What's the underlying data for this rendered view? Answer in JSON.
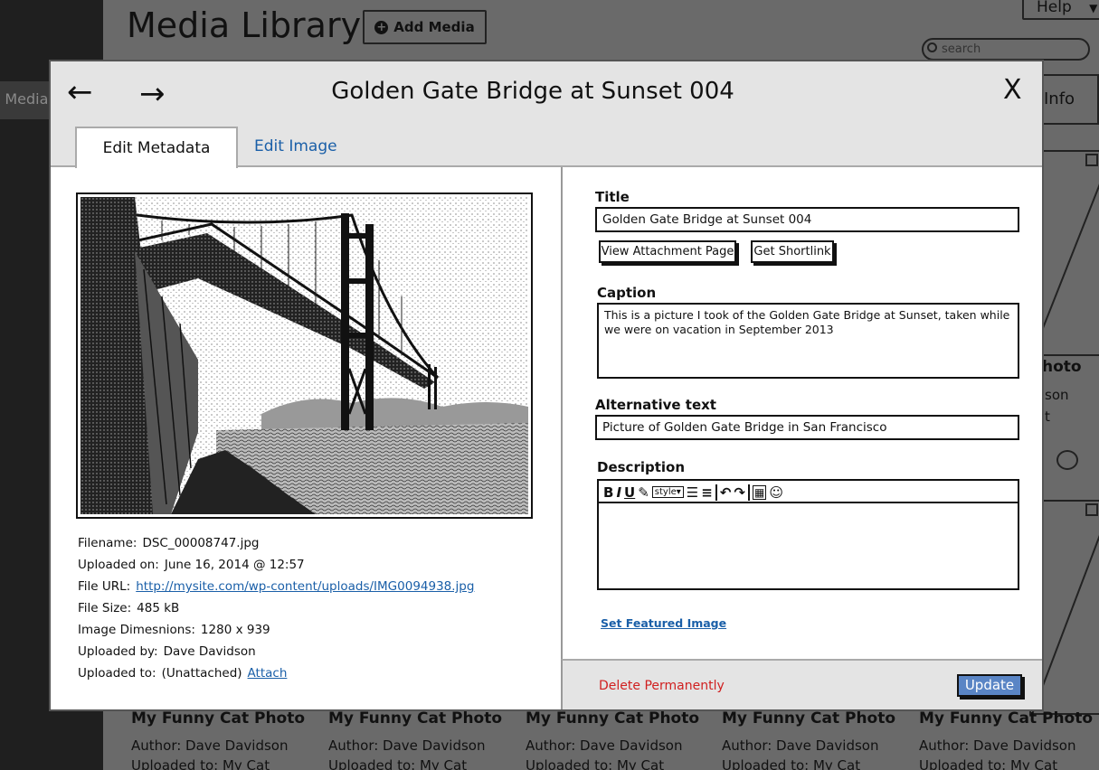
{
  "background": {
    "sidebar_active_label": "Media",
    "page_title": "Media Library",
    "add_media_label": "Add Media",
    "help_label": "Help",
    "search_placeholder": "search",
    "info_label": "Info",
    "peek": {
      "title": "hoto",
      "line1": "son",
      "line2": "t"
    },
    "cards": [
      {
        "title": "My Funny Cat Photo",
        "author": "Author: Dave Davidson",
        "uploaded": "Uploaded to: My Cat"
      },
      {
        "title": "My Funny Cat Photo",
        "author": "Author: Dave Davidson",
        "uploaded": "Uploaded to: My Cat"
      },
      {
        "title": "My Funny Cat Photo",
        "author": "Author: Dave Davidson",
        "uploaded": "Uploaded to: My Cat"
      },
      {
        "title": "My Funny Cat Photo",
        "author": "Author: Dave Davidson",
        "uploaded": "Uploaded to: My Cat"
      },
      {
        "title": "My Funny Cat Photo",
        "author": "Author: Dave Davidson",
        "uploaded": "Uploaded to: My Cat"
      }
    ]
  },
  "modal": {
    "title": "Golden Gate Bridge at Sunset 004",
    "close_label": "X",
    "prev_icon": "arrow-left-icon",
    "next_icon": "arrow-right-icon",
    "tabs": [
      {
        "label": "Edit Metadata",
        "active": true
      },
      {
        "label": "Edit Image",
        "active": false
      }
    ],
    "image": {
      "subject": "golden-gate-bridge-photo"
    },
    "metadata": {
      "filename_label": "Filename:",
      "filename": "DSC_00008747.jpg",
      "uploaded_on_label": "Uploaded on:",
      "uploaded_on": "June 16, 2014 @ 12:57",
      "file_url_label": "File URL:",
      "file_url": "http://mysite.com/wp-content/uploads/IMG0094938.jpg",
      "file_size_label": "File Size:",
      "file_size": "485 kB",
      "dimensions_label": "Image Dimesnions:",
      "dimensions": "1280 x 939",
      "uploaded_by_label": "Uploaded by:",
      "uploaded_by": "Dave Davidson",
      "uploaded_to_label": "Uploaded to:",
      "uploaded_to": "(Unattached)",
      "attach_label": "Attach"
    },
    "form": {
      "title_label": "Title",
      "title_value": "Golden Gate Bridge at Sunset 004",
      "view_attachment_label": "View Attachment Page",
      "get_shortlink_label": "Get Shortlink",
      "caption_label": "Caption",
      "caption_value": "This is a picture I took of the Golden Gate Bridge at Sunset, taken while we were on vacation in September 2013",
      "alt_label": "Alternative text",
      "alt_value": "Picture of Golden Gate Bridge in San Francisco",
      "description_label": "Description",
      "description_value": "",
      "toolbar": {
        "bold": "B",
        "italic": "I",
        "underline": "U",
        "style": "style▾"
      },
      "featured_image_label": "Set Featured Image"
    },
    "footer": {
      "delete_label": "Delete Permanently",
      "update_label": "Update"
    },
    "colors": {
      "link": "#1a5fa8",
      "delete": "#d02020",
      "update_button": "#5a85c5"
    }
  }
}
